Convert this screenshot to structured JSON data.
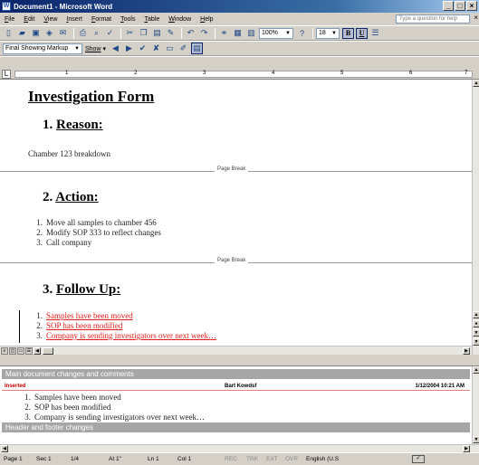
{
  "window": {
    "title": "Document1 - Microsoft Word",
    "app_icon": "W"
  },
  "menu": {
    "items": [
      "File",
      "Edit",
      "View",
      "Insert",
      "Format",
      "Tools",
      "Table",
      "Window",
      "Help"
    ],
    "help_placeholder": "Type a question for help"
  },
  "toolbar_standard": {
    "zoom": "100%",
    "font_size": "18",
    "bold": "B",
    "underline": "U"
  },
  "toolbar_reviewing": {
    "markup_mode": "Final Showing Markup",
    "show_label": "Show"
  },
  "ruler": {
    "marks": [
      "1",
      "2",
      "3",
      "4",
      "5",
      "6",
      "7"
    ]
  },
  "document": {
    "title": "Investigation Form",
    "sections": [
      {
        "heading_num": "1.",
        "heading": "Reason:"
      },
      {
        "heading_num": "2.",
        "heading": "Action:"
      },
      {
        "heading_num": "3.",
        "heading": "Follow Up:"
      }
    ],
    "reason_text": "Chamber 123 breakdown",
    "page_break_label": "Page Break",
    "actions": [
      {
        "num": "1.",
        "text": "Move all samples to chamber 456"
      },
      {
        "num": "2.",
        "text": "Modify SOP 333 to reflect changes"
      },
      {
        "num": "3.",
        "text": "Call company"
      }
    ],
    "followups": [
      {
        "num": "1.",
        "text": "Samples have been moved"
      },
      {
        "num": "2.",
        "text": "SOP has been modified"
      },
      {
        "num": "3.",
        "text": "Company is sending investigators over next week…"
      }
    ]
  },
  "reviewing_pane": {
    "main_header": "Main document changes and comments",
    "change_type": "Inserted",
    "author": "Bart Kowdsf",
    "date": "1/12/2004 10:21 AM",
    "items": [
      {
        "num": "1.",
        "text": "Samples have been moved"
      },
      {
        "num": "2.",
        "text": "SOP has been modified"
      },
      {
        "num": "3.",
        "text": "Company is sending investigators over next week…"
      }
    ],
    "footer_header": "Header and footer changes"
  },
  "status": {
    "page": "Page 1",
    "sec": "Sec 1",
    "pages": "1/4",
    "at": "At 1\"",
    "ln": "Ln 1",
    "col": "Col 1",
    "rec": "REC",
    "trk": "TRK",
    "ext": "EXT",
    "ovr": "OVR",
    "language": "English (U.S"
  },
  "colors": {
    "insertion": "#e01b1b",
    "title_bar": "#0a246a",
    "pane_header": "#a6a6a6"
  }
}
